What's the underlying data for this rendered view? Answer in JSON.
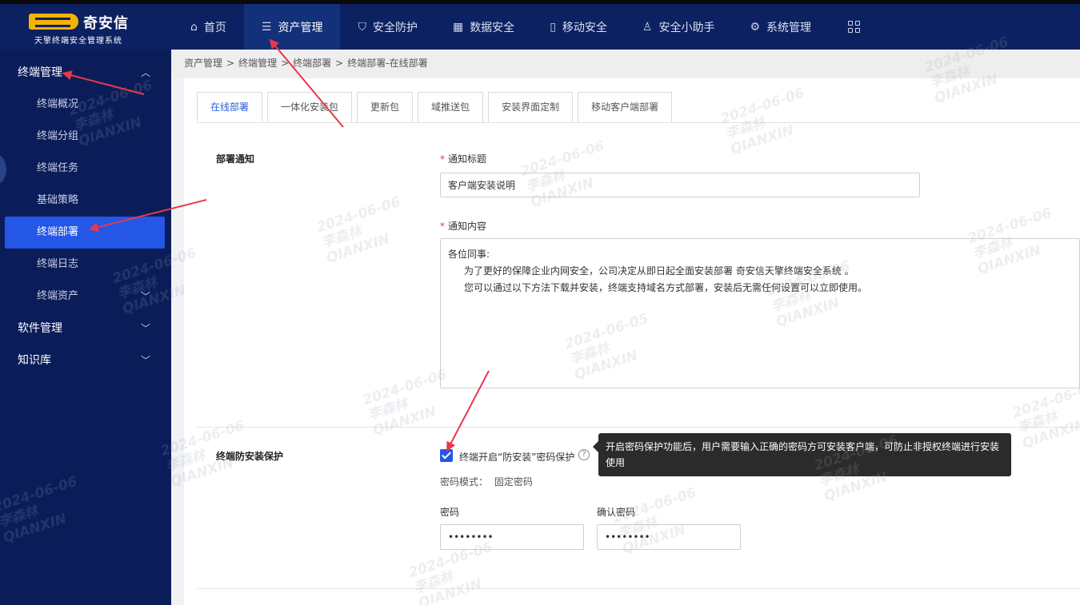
{
  "app": {
    "logo_text": "奇安信",
    "logo_sub": "天擎终端安全管理系统"
  },
  "nav": {
    "items": [
      {
        "label": "首页",
        "icon": "home-icon"
      },
      {
        "label": "资产管理",
        "icon": "database-icon"
      },
      {
        "label": "安全防护",
        "icon": "shield-icon"
      },
      {
        "label": "数据安全",
        "icon": "grid-icon"
      },
      {
        "label": "移动安全",
        "icon": "mobile-icon"
      },
      {
        "label": "安全小助手",
        "icon": "assistant-icon"
      },
      {
        "label": "系统管理",
        "icon": "settings-icon"
      }
    ],
    "active": "资产管理"
  },
  "sidebar": {
    "groups": [
      {
        "label": "终端管理",
        "expanded": true
      },
      {
        "label": "软件管理",
        "expanded": false
      },
      {
        "label": "知识库",
        "expanded": false
      }
    ],
    "items": [
      {
        "label": "终端概况"
      },
      {
        "label": "终端分组"
      },
      {
        "label": "终端任务"
      },
      {
        "label": "基础策略"
      },
      {
        "label": "终端部署"
      },
      {
        "label": "终端日志"
      },
      {
        "label": "终端资产"
      }
    ],
    "active": "终端部署"
  },
  "breadcrumb": {
    "items": [
      "资产管理",
      "终端管理",
      "终端部署",
      "终端部署-在线部署"
    ],
    "separator": ">"
  },
  "tabs": {
    "items": [
      "在线部署",
      "一体化安装包",
      "更新包",
      "域推送包",
      "安装界面定制",
      "移动客户端部署"
    ],
    "active": "在线部署"
  },
  "deploy_notice": {
    "section_label": "部署通知",
    "title_label": "通知标题",
    "title_value": "客户端安装说明",
    "content_label": "通知内容",
    "content_lines": [
      "各位同事:",
      "为了更好的保障企业内网安全，公司决定从即日起全面安装部署 奇安信天擎终端安全系统 。",
      "您可以通过以下方法下载并安装，终端支持域名方式部署，安装后无需任何设置可以立即使用。"
    ]
  },
  "protection": {
    "section_label": "终端防安装保护",
    "checkbox_label": "终端开启“防安装”密码保护",
    "checked": true,
    "mode_label": "密码模式：",
    "mode_value": "固定密码",
    "password_label": "密码",
    "password_value": "••••••••",
    "confirm_label": "确认密码",
    "confirm_value": "••••••••",
    "tooltip": "开启密码保护功能后，用户需要输入正确的密码方可安装客户端，可防止非授权终端进行安装使用"
  },
  "watermark": {
    "date_lines": [
      "2024-06-06",
      "2024-06-05"
    ],
    "name": "李森林",
    "company": "QIANXIN"
  },
  "colors": {
    "topbar": "#0c2161",
    "sidebar": "#0b1d59",
    "accent": "#2457e6",
    "annotation_arrow": "#e8384b"
  }
}
